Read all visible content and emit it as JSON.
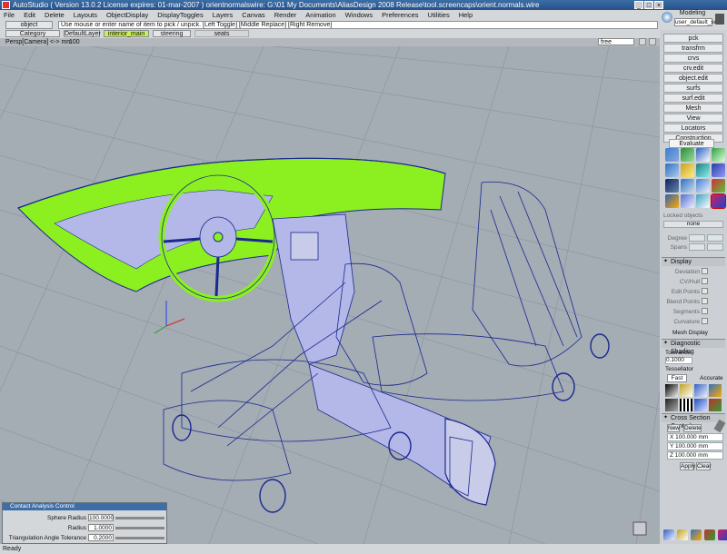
{
  "window": {
    "title": "AutoStudio ( Version 13.0.2  License expires: 01-mar-2007 ) orientnormalswire: G:\\01 My Documents\\AliasDesign 2008 Release\\tool.screencaps\\orient.normals.wire",
    "controls": [
      "_",
      "□",
      "×"
    ]
  },
  "menu": [
    "File",
    "Edit",
    "Delete",
    "Layouts",
    "ObjectDisplay",
    "DisplayToggles",
    "Layers",
    "Canvas",
    "Render",
    "Animation",
    "Windows",
    "Preferences",
    "Utilities",
    "Help"
  ],
  "pick": {
    "button": "object",
    "message": "Use mouse or enter name of item to pick / unpick. [Left Toggle] [Middle Replace] [Right Remove]"
  },
  "layers": [
    "Category",
    "DefaultLayer",
    "interior_main",
    "steering",
    "seats"
  ],
  "viewport": {
    "label": "Persp[Camera]  <-> mm",
    "zoom": "100",
    "cam_mode": "free",
    "colors": {
      "bg": "#a4acb4",
      "wire": "#1a2890",
      "highlight": "#8cf020",
      "fill": "#b4b8e8"
    }
  },
  "user": {
    "mode": "Modeling",
    "name": "user_default_scm"
  },
  "palette_tabs": [
    "pck",
    "transfrm",
    "crvs",
    "crv.edit",
    "object.edit",
    "surfs",
    "surf.edit",
    "Mesh",
    "View",
    "Locators",
    "Construction",
    "Evaluate"
  ],
  "locked_objects": {
    "label": "Locked objects",
    "value": "none"
  },
  "degree_spans": {
    "degree": "Degree",
    "spans": "Spans"
  },
  "display": {
    "title": "Display",
    "rows": [
      "Deviation",
      "CV/Hull",
      "Edit Points",
      "Blend Points",
      "Segments",
      "Curvature"
    ],
    "mesh_label": "Mesh Display"
  },
  "shading": {
    "title": "Diagnostic Shading",
    "tolerance_label": "Tolerance",
    "tolerance_value": "0.1000",
    "tessellator_label": "Tessellator",
    "fast": "Fast",
    "accurate": "Accurate"
  },
  "cross_section": {
    "title": "Cross Section Control",
    "new": "New",
    "delete": "Delete",
    "x": "X 100.000 mm",
    "y": "Y 100.000 mm",
    "z": "Z 100.000 mm",
    "apply": "Apply",
    "clear": "Clear"
  },
  "contact_dialog": {
    "title": "Contact Analysis Control",
    "rows": [
      {
        "label": "Sphere Radius",
        "value": "100.0000"
      },
      {
        "label": "Radius",
        "value": "1.0000"
      },
      {
        "label": "Triangulation Angle Tolerance",
        "value": "0.2000"
      }
    ]
  },
  "status": "Ready"
}
